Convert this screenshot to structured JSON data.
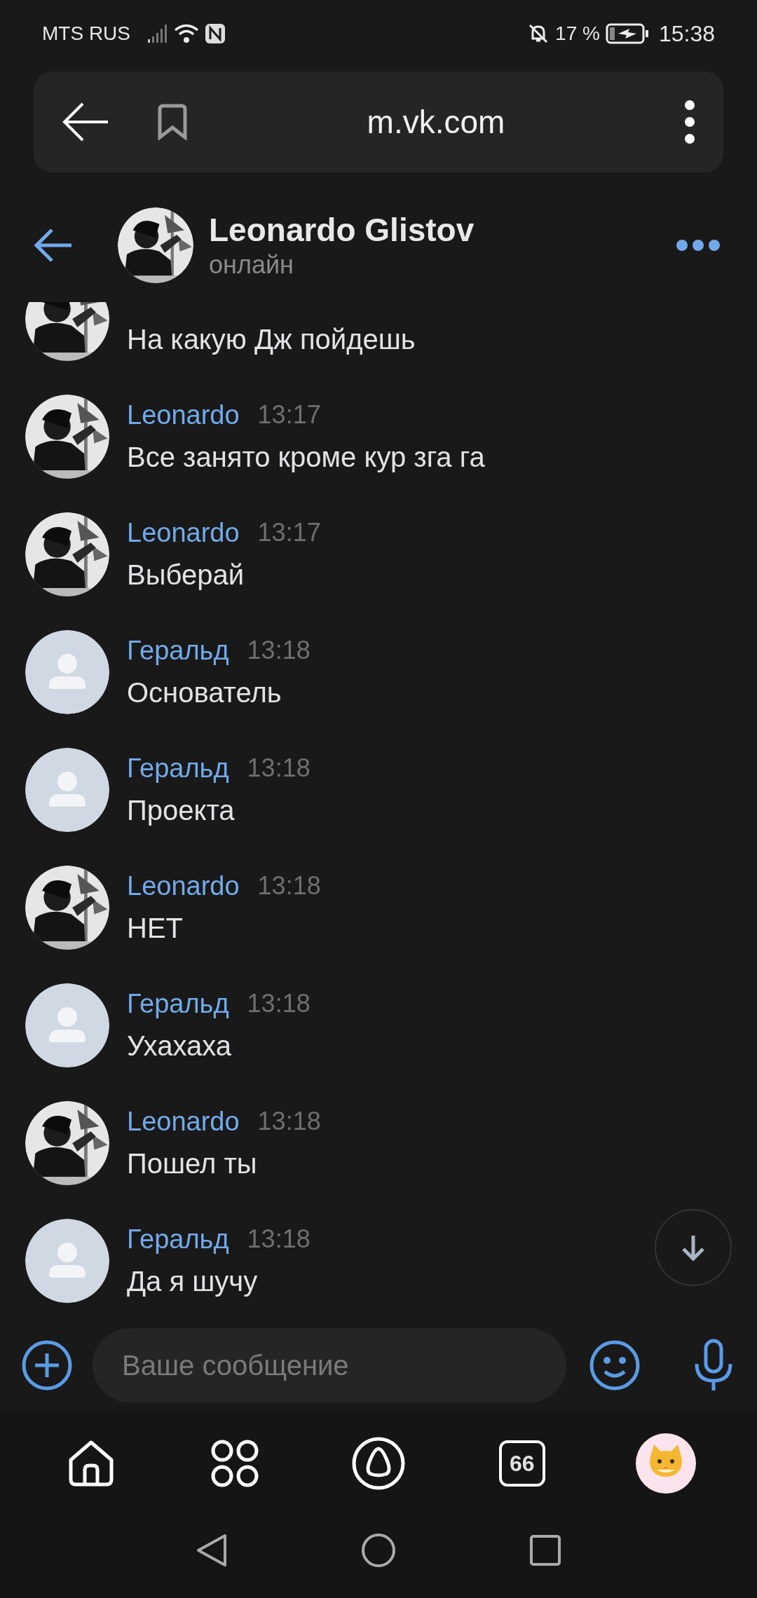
{
  "status_bar": {
    "carrier": "MTS RUS",
    "battery": "17 %",
    "time": "15:38"
  },
  "browser_bar": {
    "url": "m.vk.com"
  },
  "chat_header": {
    "name": "Leonardo Glistov",
    "status": "онлайн"
  },
  "messages": [
    {
      "text": "На какую Дж пойдешь"
    },
    {
      "author": "Leonardo",
      "time": "13:17",
      "text": "Все занято кроме кур зга га"
    },
    {
      "author": "Leonardo",
      "time": "13:17",
      "text": "Выберай"
    },
    {
      "author": "Геральд",
      "time": "13:18",
      "kind": "default",
      "text": "Основатель"
    },
    {
      "author": "Геральд",
      "time": "13:18",
      "kind": "default",
      "text": "Проекта"
    },
    {
      "author": "Leonardo",
      "time": "13:18",
      "text": "НЕТ"
    },
    {
      "author": "Геральд",
      "time": "13:18",
      "kind": "default",
      "text": "Ухахаха"
    },
    {
      "author": "Leonardo",
      "time": "13:18",
      "text": "Пошел ты"
    },
    {
      "author": "Геральд",
      "time": "13:18",
      "kind": "default",
      "text": "Да я шучу"
    }
  ],
  "composer": {
    "placeholder": "Ваше сообщение"
  },
  "bottom_nav": [
    {
      "kind": "home"
    },
    {
      "kind": "apps"
    },
    {
      "kind": "assistant"
    },
    {
      "kind": "counter",
      "label": "66"
    },
    {
      "kind": "profile"
    }
  ]
}
